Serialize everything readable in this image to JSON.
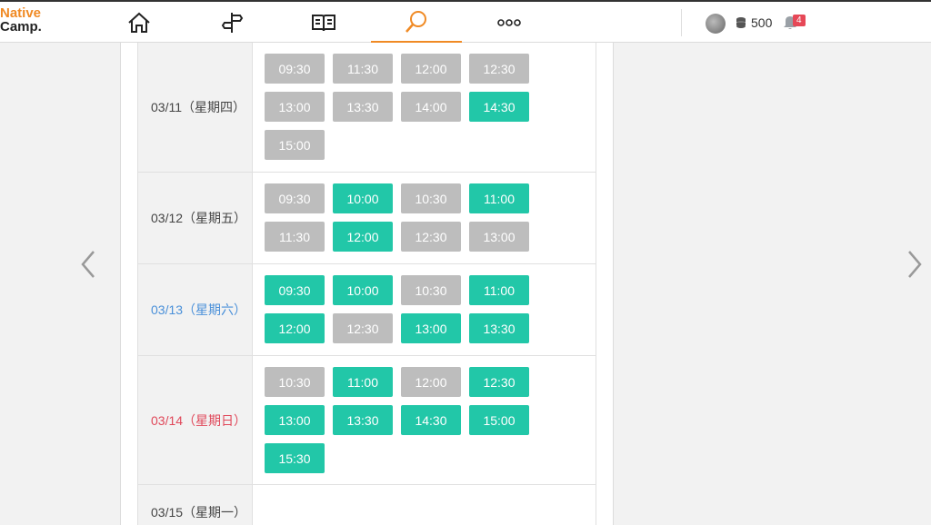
{
  "header": {
    "logo_line1": "Native",
    "logo_line2": "Camp.",
    "coins": "500",
    "notifications": "4"
  },
  "schedule": [
    {
      "date": "03/11（星期四）",
      "day_type": "weekday",
      "slots": [
        {
          "time": "09:30",
          "available": false
        },
        {
          "time": "11:30",
          "available": false
        },
        {
          "time": "12:00",
          "available": false
        },
        {
          "time": "12:30",
          "available": false
        },
        {
          "time": "13:00",
          "available": false
        },
        {
          "time": "13:30",
          "available": false
        },
        {
          "time": "14:00",
          "available": false
        },
        {
          "time": "14:30",
          "available": true
        },
        {
          "time": "15:00",
          "available": false
        }
      ]
    },
    {
      "date": "03/12（星期五）",
      "day_type": "weekday",
      "slots": [
        {
          "time": "09:30",
          "available": false
        },
        {
          "time": "10:00",
          "available": true
        },
        {
          "time": "10:30",
          "available": false
        },
        {
          "time": "11:00",
          "available": true
        },
        {
          "time": "11:30",
          "available": false
        },
        {
          "time": "12:00",
          "available": true
        },
        {
          "time": "12:30",
          "available": false
        },
        {
          "time": "13:00",
          "available": false
        }
      ]
    },
    {
      "date": "03/13（星期六）",
      "day_type": "saturday",
      "slots": [
        {
          "time": "09:30",
          "available": true
        },
        {
          "time": "10:00",
          "available": true
        },
        {
          "time": "10:30",
          "available": false
        },
        {
          "time": "11:00",
          "available": true
        },
        {
          "time": "12:00",
          "available": true
        },
        {
          "time": "12:30",
          "available": false
        },
        {
          "time": "13:00",
          "available": true
        },
        {
          "time": "13:30",
          "available": true
        }
      ]
    },
    {
      "date": "03/14（星期日）",
      "day_type": "sunday",
      "slots": [
        {
          "time": "10:30",
          "available": false
        },
        {
          "time": "11:00",
          "available": true
        },
        {
          "time": "12:00",
          "available": false
        },
        {
          "time": "12:30",
          "available": true
        },
        {
          "time": "13:00",
          "available": true
        },
        {
          "time": "13:30",
          "available": true
        },
        {
          "time": "14:30",
          "available": true
        },
        {
          "time": "15:00",
          "available": true
        },
        {
          "time": "15:30",
          "available": true
        }
      ]
    },
    {
      "date": "03/15（星期一）",
      "day_type": "weekday",
      "slots": []
    }
  ],
  "colors": {
    "accent": "#f08a24",
    "available": "#22c7a8",
    "unavailable": "#bdbdbd",
    "saturday": "#4a90d9",
    "sunday": "#e0485a"
  },
  "icons": [
    "home-icon",
    "signpost-icon",
    "book-icon",
    "search-icon",
    "more-icon",
    "coin-icon",
    "bell-icon",
    "prev-arrow-icon",
    "next-arrow-icon"
  ]
}
